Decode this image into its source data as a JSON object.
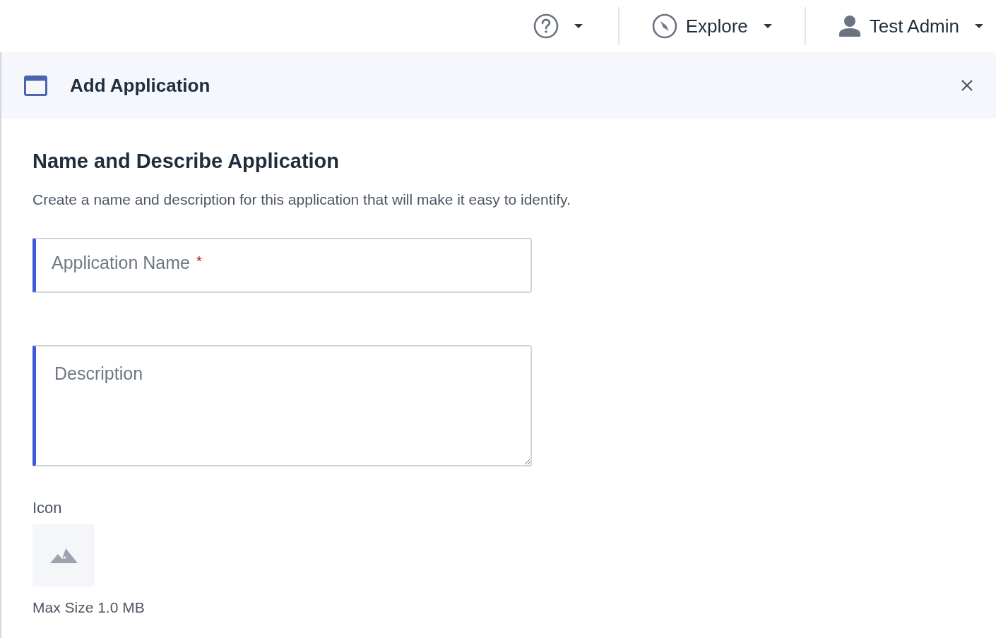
{
  "top_bar": {
    "explore_menu": {
      "label": "Explore"
    },
    "user_menu": {
      "label": "Test Admin"
    }
  },
  "panel": {
    "title": "Add Application"
  },
  "section": {
    "heading": "Name and Describe Application",
    "description": "Create a name and description for this application that will make it easy to identify."
  },
  "name_field": {
    "placeholder": "Application Name",
    "required_mark": "*"
  },
  "description_field": {
    "placeholder": "Description"
  },
  "icon_upload": {
    "label": "Icon",
    "hint": "Max Size 1.0 MB"
  }
}
